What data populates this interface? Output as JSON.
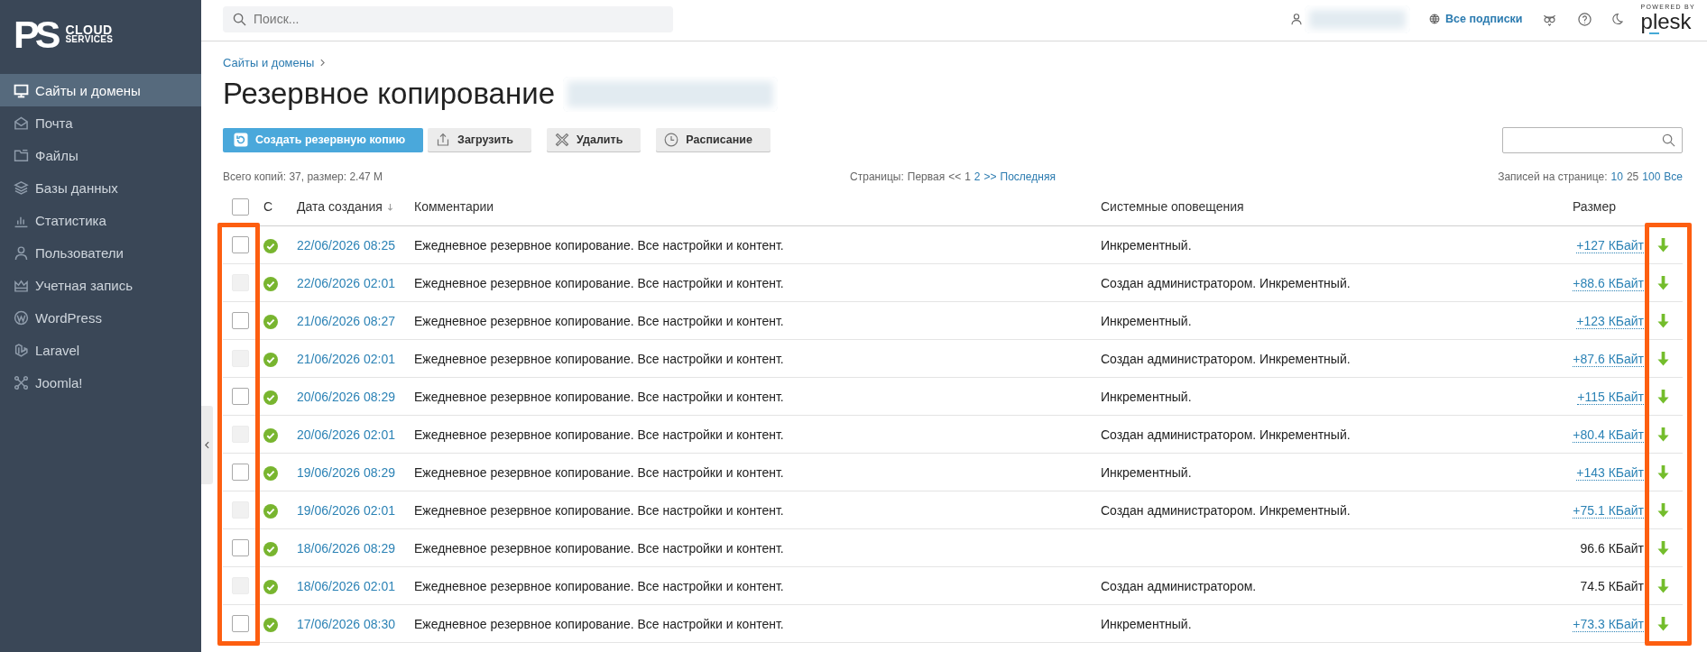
{
  "sidebar": {
    "logo": {
      "mark": "PS",
      "line1": "CLOUD",
      "line2": "SERVICES"
    },
    "items": [
      {
        "label": "Сайты и домены",
        "selected": true
      },
      {
        "label": "Почта",
        "selected": false
      },
      {
        "label": "Файлы",
        "selected": false
      },
      {
        "label": "Базы данных",
        "selected": false
      },
      {
        "label": "Статистика",
        "selected": false
      },
      {
        "label": "Пользователи",
        "selected": false
      },
      {
        "label": "Учетная запись",
        "selected": false
      },
      {
        "label": "WordPress",
        "selected": false
      },
      {
        "label": "Laravel",
        "selected": false
      },
      {
        "label": "Joomla!",
        "selected": false
      }
    ]
  },
  "top_bar": {
    "search": {
      "placeholder": "Поиск..."
    },
    "subscriptions_link": "Все подписки",
    "powered_by": "POWERED BY",
    "brand": "plesk"
  },
  "breadcrumb": [
    "Сайты и домены"
  ],
  "title": "Резервное копирование",
  "toolbar": {
    "buttons": [
      {
        "label": "Создать резервную копию",
        "kind": "primary"
      },
      {
        "label": "Загрузить",
        "kind": "secondary"
      },
      {
        "label": "Удалить",
        "kind": "secondary"
      },
      {
        "label": "Расписание",
        "kind": "secondary"
      }
    ]
  },
  "summary": "Всего копий: 37, размер: 2.47 M",
  "pagination": {
    "label": "Страницы:",
    "items": [
      {
        "text": "Первая",
        "link": false
      },
      {
        "text": "<<",
        "link": false
      },
      {
        "text": "1",
        "link": false
      },
      {
        "text": "2",
        "link": true
      },
      {
        "text": ">>",
        "link": true
      },
      {
        "text": "Последняя",
        "link": true
      }
    ]
  },
  "per_page": {
    "label": "Записей на странице:",
    "options": [
      {
        "text": "10",
        "selected": false
      },
      {
        "text": "25",
        "selected": true
      },
      {
        "text": "100",
        "selected": false
      },
      {
        "text": "Все",
        "selected": false
      }
    ]
  },
  "table": {
    "select_all": {
      "checked": false
    },
    "columns": [
      {
        "label": "С",
        "sorted": false
      },
      {
        "label": "Дата создания",
        "sorted": true
      },
      {
        "label": "Комментарии",
        "sorted": false
      },
      {
        "label": "Системные оповещения",
        "sorted": false
      },
      {
        "label": "Размер",
        "sorted": false
      }
    ],
    "rows": [
      {
        "checked": false,
        "disabled": false,
        "completed": true,
        "date": "22/06/2026 08:25",
        "comment": "Ежедневное резервное копирование. Все настройки и контент.",
        "notes": "Инкрементный.",
        "size": "+127 КБайт",
        "size_link": true
      },
      {
        "checked": false,
        "disabled": true,
        "completed": true,
        "date": "22/06/2026 02:01",
        "comment": "Ежедневное резервное копирование. Все настройки и контент.",
        "notes": "Создан администратором. Инкрементный.",
        "size": "+88.6 КБайт",
        "size_link": true
      },
      {
        "checked": false,
        "disabled": false,
        "completed": true,
        "date": "21/06/2026 08:27",
        "comment": "Ежедневное резервное копирование. Все настройки и контент.",
        "notes": "Инкрементный.",
        "size": "+123 КБайт",
        "size_link": true
      },
      {
        "checked": false,
        "disabled": true,
        "completed": true,
        "date": "21/06/2026 02:01",
        "comment": "Ежедневное резервное копирование. Все настройки и контент.",
        "notes": "Создан администратором. Инкрементный.",
        "size": "+87.6 КБайт",
        "size_link": true
      },
      {
        "checked": false,
        "disabled": false,
        "completed": true,
        "date": "20/06/2026 08:29",
        "comment": "Ежедневное резервное копирование. Все настройки и контент.",
        "notes": "Инкрементный.",
        "size": "+115 КБайт",
        "size_link": true
      },
      {
        "checked": false,
        "disabled": true,
        "completed": true,
        "date": "20/06/2026 02:01",
        "comment": "Ежедневное резервное копирование. Все настройки и контент.",
        "notes": "Создан администратором. Инкрементный.",
        "size": "+80.4 КБайт",
        "size_link": true
      },
      {
        "checked": false,
        "disabled": false,
        "completed": true,
        "date": "19/06/2026 08:29",
        "comment": "Ежедневное резервное копирование. Все настройки и контент.",
        "notes": "Инкрементный.",
        "size": "+143 КБайт",
        "size_link": true
      },
      {
        "checked": false,
        "disabled": true,
        "completed": true,
        "date": "19/06/2026 02:01",
        "comment": "Ежедневное резервное копирование. Все настройки и контент.",
        "notes": "Создан администратором. Инкрементный.",
        "size": "+75.1 КБайт",
        "size_link": true
      },
      {
        "checked": false,
        "disabled": false,
        "completed": true,
        "date": "18/06/2026 08:29",
        "comment": "Ежедневное резервное копирование. Все настройки и контент.",
        "size": "96.6 КБайт",
        "size_link": false
      },
      {
        "checked": false,
        "disabled": true,
        "completed": true,
        "date": "18/06/2026 02:01",
        "comment": "Ежедневное резервное копирование. Все настройки и контент.",
        "notes": "Создан администратором.",
        "size": "74.5 КБайт",
        "size_link": false
      },
      {
        "checked": false,
        "disabled": false,
        "completed": true,
        "date": "17/06/2026 08:30",
        "comment": "Ежедневное резервное копирование. Все настройки и контент.",
        "notes": "Инкрементный.",
        "size": "+73.3 КБайт",
        "size_link": true
      }
    ]
  }
}
